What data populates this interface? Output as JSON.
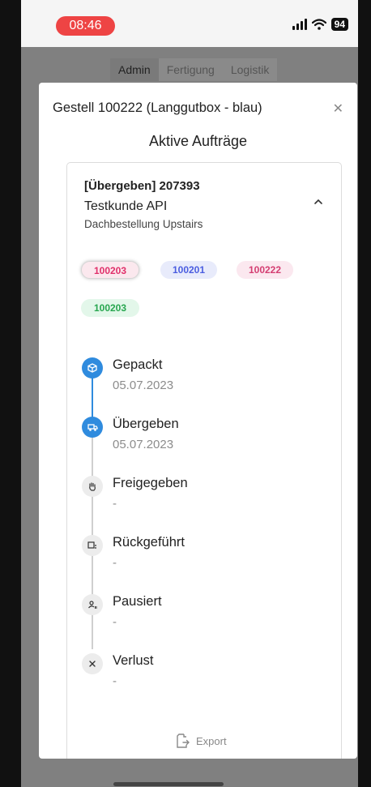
{
  "status_bar": {
    "time": "08:46",
    "battery": "94"
  },
  "background_tabs": [
    "Admin",
    "Fertigung",
    "Logistik"
  ],
  "modal": {
    "title": "Gestell 100222 (Langgutbox - blau)",
    "subtitle": "Aktive Aufträge",
    "order": {
      "status_line": "[Übergeben] 207393",
      "customer": "Testkunde API",
      "description": "Dachbestellung Upstairs",
      "tags": [
        {
          "label": "100203",
          "color": "#e0306a"
        },
        {
          "label": "100201",
          "color": "#4a5de0"
        },
        {
          "label": "100222",
          "color": "#d43e72"
        },
        {
          "label": "100203",
          "color": "#27a64f"
        }
      ],
      "timeline": [
        {
          "label": "Gepackt",
          "date": "05.07.2023",
          "icon": "package-icon",
          "done": true
        },
        {
          "label": "Übergeben",
          "date": "05.07.2023",
          "icon": "truck-icon",
          "done": true
        },
        {
          "label": "Freigegeben",
          "date": "-",
          "icon": "hand-icon",
          "done": false
        },
        {
          "label": "Rückgeführt",
          "date": "-",
          "icon": "return-icon",
          "done": false
        },
        {
          "label": "Pausiert",
          "date": "-",
          "icon": "user-pause-icon",
          "done": false
        },
        {
          "label": "Verlust",
          "date": "-",
          "icon": "x-icon",
          "done": false
        }
      ]
    },
    "export_label": "Export"
  },
  "colors": {
    "accent": "#2f8bde",
    "time_pill": "#ee4444"
  }
}
